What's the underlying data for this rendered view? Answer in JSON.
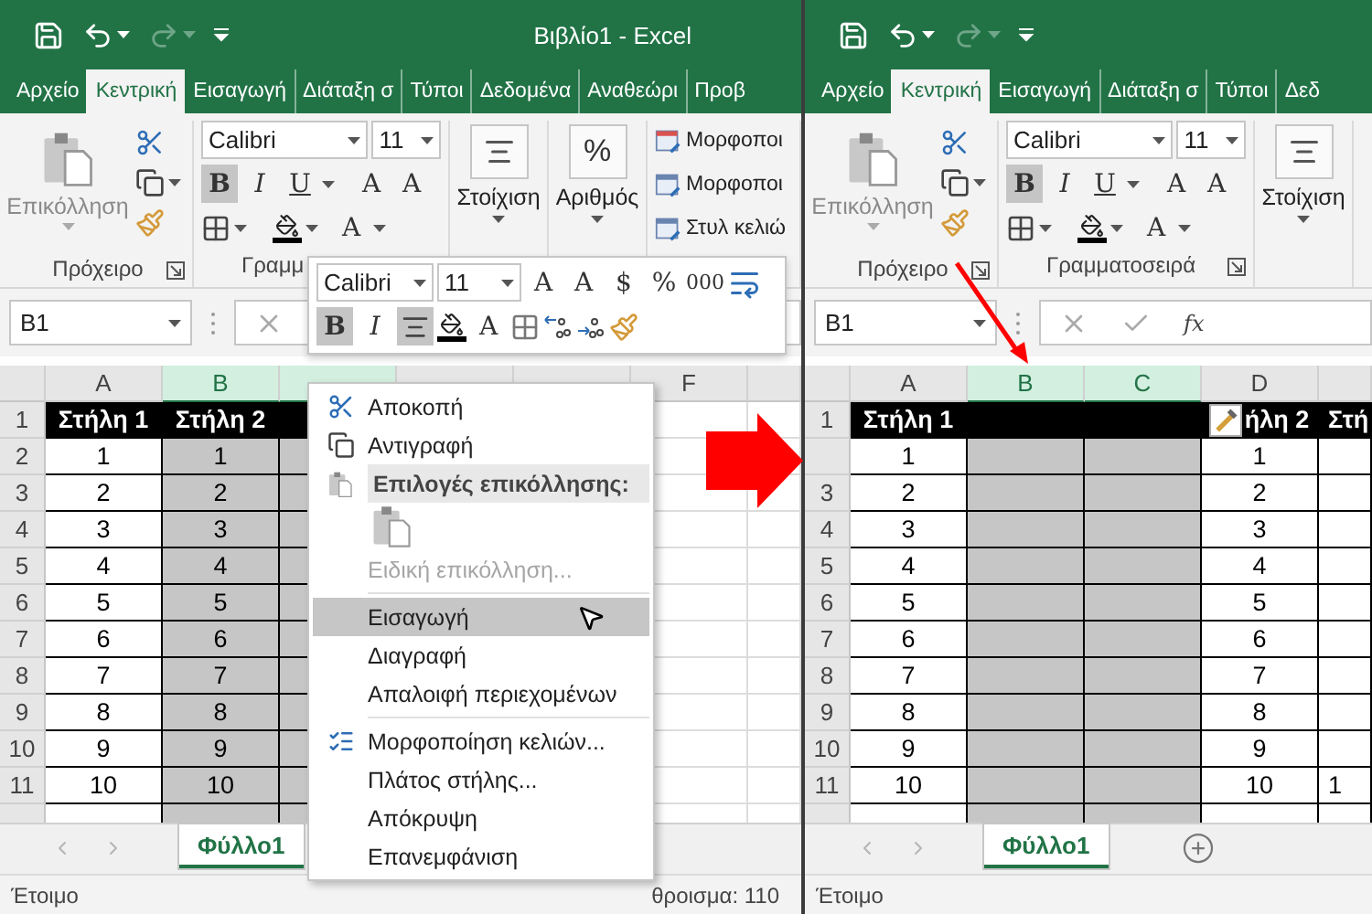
{
  "windows": [
    {
      "title": "Βιβλίο1 - Excel",
      "redo_disabled": true,
      "tabs": [
        {
          "label": "Αρχείο",
          "selected": false
        },
        {
          "label": "Κεντρική",
          "selected": true
        },
        {
          "label": "Εισαγωγή",
          "selected": false
        },
        {
          "label": "Διάταξη σ",
          "selected": false
        },
        {
          "label": "Τύποι",
          "selected": false
        },
        {
          "label": "Δεδομένα",
          "selected": false
        },
        {
          "label": "Αναθεώρι",
          "selected": false
        },
        {
          "label": "Προβ",
          "selected": false
        }
      ],
      "ribbon": [
        {
          "kind": "clipboard",
          "paste": "Επικόλληση",
          "paste_disabled": true,
          "label": "Πρόχειρο",
          "launcher": true
        },
        {
          "kind": "font",
          "font": "Calibri",
          "size": "11",
          "styles": [
            {
              "text": "B",
              "selected": true
            },
            {
              "text": "I",
              "selected": false
            },
            {
              "text": "U",
              "selected": false
            }
          ],
          "grow": "A",
          "shrink": "A",
          "color_letter": "A",
          "label": "Γραμμ"
        },
        {
          "kind": "alignment",
          "label": "Στοίχιση"
        },
        {
          "kind": "number",
          "glyph": "%",
          "label": "Αριθμός"
        },
        {
          "kind": "styles",
          "items": [
            "Μορφοποι",
            "Μορφοποι",
            "Στυλ κελιώ"
          ]
        }
      ],
      "name_box": "B1",
      "formula_buttons": [
        {
          "kind": "cancel"
        }
      ],
      "columns": [
        {
          "label": "A",
          "selected": false,
          "kind": "value"
        },
        {
          "label": "B",
          "selected": true,
          "kind": "shaded"
        },
        {
          "selected": true,
          "kind": "shaded"
        },
        {
          "selected": false,
          "kind": "blank"
        },
        {
          "selected": false,
          "kind": "blank"
        },
        {
          "label": "F",
          "selected": false,
          "kind": "blank"
        },
        {
          "selected": false,
          "kind": "blank"
        }
      ],
      "rows": [
        {
          "header": "1",
          "kind": "title",
          "cells": [
            "Στήλη 1",
            "Στήλη 2"
          ]
        },
        {
          "header": "2",
          "kind": "data",
          "cells": [
            "1",
            "1"
          ]
        },
        {
          "header": "3",
          "kind": "data",
          "cells": [
            "2",
            "2"
          ]
        },
        {
          "header": "4",
          "kind": "data",
          "cells": [
            "3",
            "3"
          ]
        },
        {
          "header": "5",
          "kind": "data",
          "cells": [
            "4",
            "4"
          ]
        },
        {
          "header": "6",
          "kind": "data",
          "cells": [
            "5",
            "5"
          ]
        },
        {
          "header": "7",
          "kind": "data",
          "cells": [
            "6",
            "6"
          ]
        },
        {
          "header": "8",
          "kind": "data",
          "cells": [
            "7",
            "7"
          ]
        },
        {
          "header": "9",
          "kind": "data",
          "cells": [
            "8",
            "8"
          ]
        },
        {
          "header": "10",
          "kind": "data",
          "cells": [
            "9",
            "9"
          ]
        },
        {
          "header": "11",
          "kind": "data",
          "cells": [
            "10",
            "10"
          ]
        },
        {
          "kind": "data"
        }
      ],
      "sheet_tabs": [
        {
          "label": "Φύλλο1",
          "selected": true
        }
      ],
      "status": "Έτοιμο",
      "status_sum": "θροισμα: 110"
    },
    {
      "redo_disabled": true,
      "tabs": [
        {
          "label": "Αρχείο",
          "selected": false
        },
        {
          "label": "Κεντρική",
          "selected": true
        },
        {
          "label": "Εισαγωγή",
          "selected": false
        },
        {
          "label": "Διάταξη σ",
          "selected": false
        },
        {
          "label": "Τύποι",
          "selected": false
        },
        {
          "label": "Δεδ",
          "selected": false
        }
      ],
      "ribbon": [
        {
          "kind": "clipboard",
          "paste": "Επικόλληση",
          "paste_disabled": true,
          "label": "Πρόχειρο",
          "launcher": true
        },
        {
          "kind": "font",
          "font": "Calibri",
          "size": "11",
          "styles": [
            {
              "text": "B",
              "selected": true
            },
            {
              "text": "I",
              "selected": false
            },
            {
              "text": "U",
              "selected": false
            }
          ],
          "grow": "A",
          "shrink": "A",
          "color_letter": "A",
          "label": "Γραμματοσειρά",
          "launcher": true
        },
        {
          "kind": "alignment",
          "label": "Στοίχιση"
        }
      ],
      "name_box": "B1",
      "formula_buttons": [
        {
          "kind": "cancel"
        },
        {
          "kind": "enter"
        },
        {
          "kind": "function",
          "text": "fx"
        }
      ],
      "columns": [
        {
          "label": "A",
          "selected": false,
          "kind": "value"
        },
        {
          "label": "B",
          "selected": true,
          "kind": "shaded"
        },
        {
          "label": "C",
          "selected": true,
          "kind": "shaded"
        },
        {
          "label": "D",
          "selected": false,
          "kind": "value"
        },
        {
          "selected": false,
          "kind": "value"
        }
      ],
      "rows": [
        {
          "header": "1",
          "kind": "title",
          "cells": [
            "Στήλη 1",
            null,
            null,
            {
              "text": "ήλη 2",
              "smart_tag": true
            },
            "Στή"
          ]
        },
        {
          "kind": "data",
          "cells": [
            "1",
            null,
            null,
            "1"
          ]
        },
        {
          "header": "3",
          "kind": "data",
          "cells": [
            "2",
            null,
            null,
            "2"
          ]
        },
        {
          "header": "4",
          "kind": "data",
          "cells": [
            "3",
            null,
            null,
            "3"
          ]
        },
        {
          "header": "5",
          "kind": "data",
          "cells": [
            "4",
            null,
            null,
            "4"
          ]
        },
        {
          "header": "6",
          "kind": "data",
          "cells": [
            "5",
            null,
            null,
            "5"
          ]
        },
        {
          "header": "7",
          "kind": "data",
          "cells": [
            "6",
            null,
            null,
            "6"
          ]
        },
        {
          "header": "8",
          "kind": "data",
          "cells": [
            "7",
            null,
            null,
            "7"
          ]
        },
        {
          "header": "9",
          "kind": "data",
          "cells": [
            "8",
            null,
            null,
            "8"
          ]
        },
        {
          "header": "10",
          "kind": "data",
          "cells": [
            "9",
            null,
            null,
            "9"
          ]
        },
        {
          "header": "11",
          "kind": "data",
          "cells": [
            "10",
            null,
            null,
            "10",
            "1"
          ]
        },
        {
          "kind": "data"
        }
      ],
      "sheet_tabs": [
        {
          "label": "Φύλλο1",
          "selected": true
        }
      ],
      "add_sheet": true,
      "status": "Έτοιμο"
    }
  ],
  "mini_toolbar": {
    "font": "Calibri",
    "size": "11",
    "row1": [
      {
        "kind": "grow",
        "text": "A"
      },
      {
        "kind": "shrink",
        "text": "A"
      },
      {
        "kind": "currency",
        "text": "$"
      },
      {
        "kind": "percent",
        "text": "%"
      },
      {
        "kind": "comma",
        "text": "000"
      },
      {
        "kind": "wrap"
      }
    ],
    "row2": [
      {
        "kind": "toggle",
        "text": "B",
        "selected": true
      },
      {
        "kind": "italic",
        "text": "I",
        "selected": false
      },
      {
        "kind": "center",
        "selected": true
      },
      {
        "kind": "fill"
      },
      {
        "kind": "font_color",
        "text": "A"
      },
      {
        "kind": "borders"
      },
      {
        "kind": "increase_decimal"
      },
      {
        "kind": "decrease_decimal"
      },
      {
        "kind": "painter"
      }
    ]
  },
  "context_menu": {
    "items": [
      {
        "kind": "cut",
        "text": "Αποκοπή",
        "selected": false,
        "disabled": false
      },
      {
        "kind": "copy",
        "text": "Αντιγραφή",
        "selected": false,
        "disabled": false
      },
      {
        "kind": "heading",
        "text": "Επιλογές επικόλλησης:"
      },
      {
        "kind": "paste_options"
      },
      {
        "kind": "item",
        "text": "Ειδική επικόλληση...",
        "selected": false,
        "disabled": true
      },
      {
        "kind": "separator"
      },
      {
        "kind": "item",
        "text": "Εισαγωγή",
        "selected": true,
        "disabled": false
      },
      {
        "kind": "item",
        "text": "Διαγραφή",
        "selected": false,
        "disabled": false
      },
      {
        "kind": "item",
        "text": "Απαλοιφή περιεχομένων",
        "selected": false,
        "disabled": false
      },
      {
        "kind": "separator"
      },
      {
        "kind": "format",
        "text": "Μορφοποίηση κελιών...",
        "selected": false,
        "disabled": false
      },
      {
        "kind": "item",
        "text": "Πλάτος στήλης...",
        "selected": false,
        "disabled": false
      },
      {
        "kind": "item",
        "text": "Απόκρυψη",
        "selected": false,
        "disabled": false
      },
      {
        "kind": "item",
        "text": "Επανεμφάνιση",
        "selected": false,
        "disabled": false
      }
    ]
  },
  "annotations": {
    "block_arrow": true,
    "pointer_arrow": true
  }
}
